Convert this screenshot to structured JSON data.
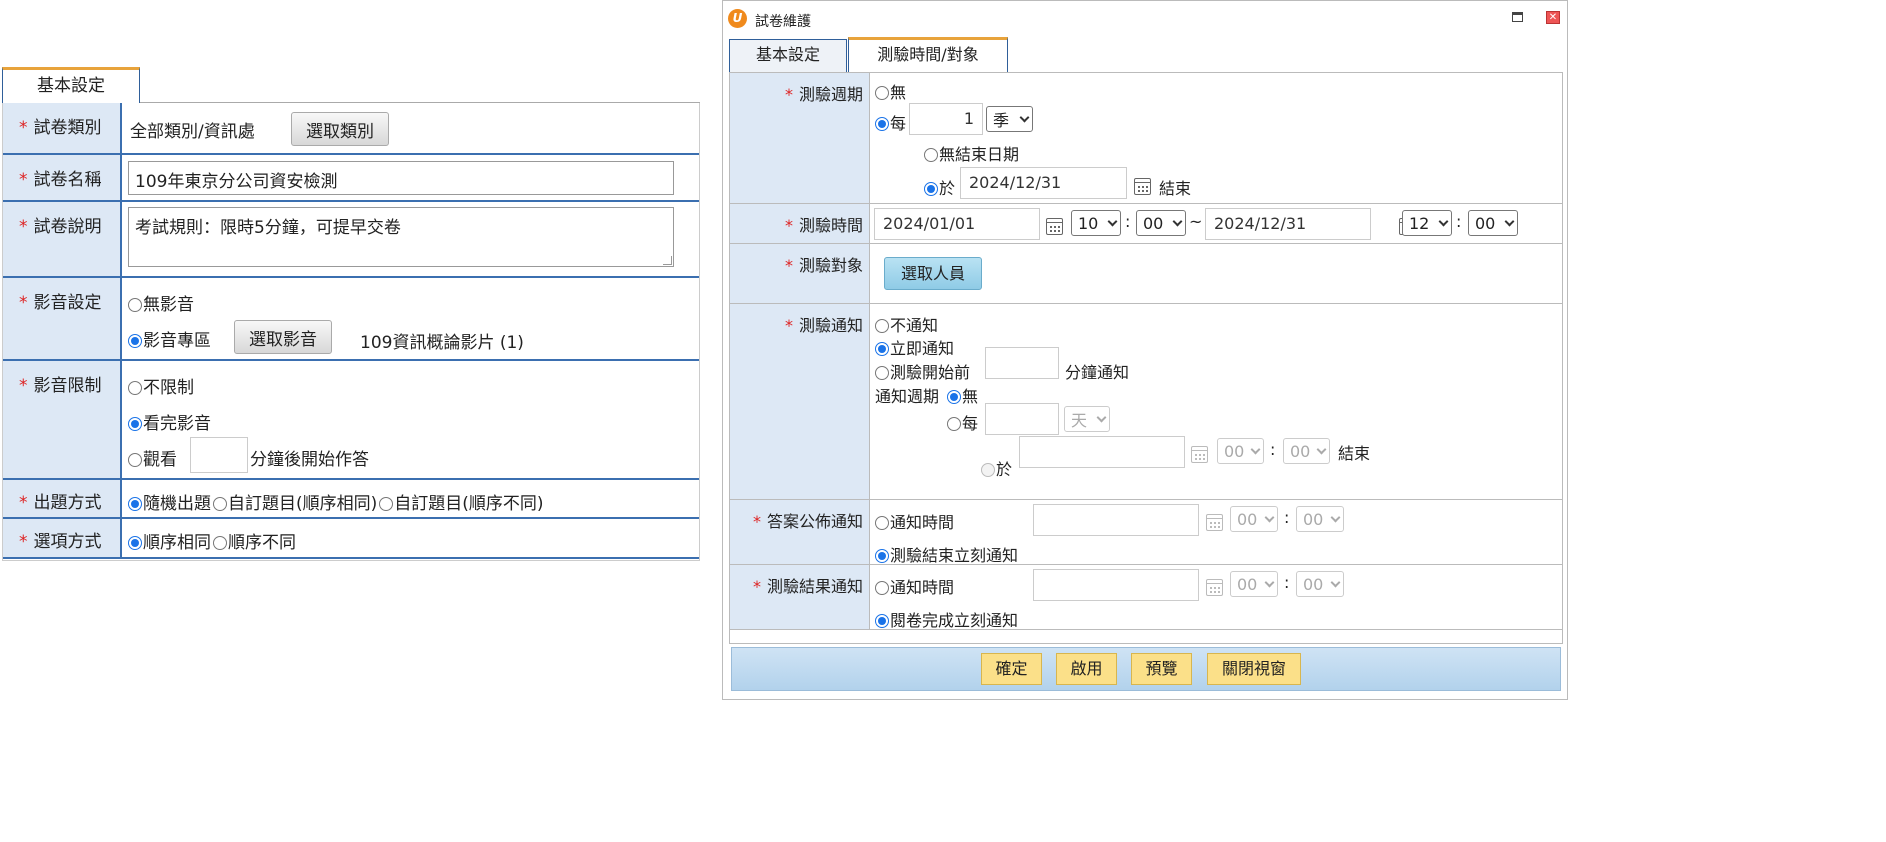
{
  "left": {
    "tab": "基本設定",
    "category": {
      "label": "試卷類別",
      "value": "全部類別/資訊處",
      "button": "選取類別"
    },
    "name": {
      "label": "試卷名稱",
      "value": "109年東京分公司資安檢測"
    },
    "desc": {
      "label": "試卷說明",
      "value": "考試規則：限時5分鐘，可提早交卷"
    },
    "media": {
      "label": "影音設定",
      "opt_none": "無影音",
      "opt_area": "影音專區",
      "button": "選取影音",
      "selected": "109資訊概論影片 (1)"
    },
    "media_limit": {
      "label": "影音限制",
      "opt1": "不限制",
      "opt2": "看完影音",
      "opt3_pre": "觀看",
      "opt3_value": "",
      "opt3_post": "分鐘後開始作答"
    },
    "question_mode": {
      "label": "出題方式",
      "opt1": "隨機出題",
      "opt2": "自訂題目(順序相同)",
      "opt3": "自訂題目(順序不同)"
    },
    "option_mode": {
      "label": "選項方式",
      "opt1": "順序相同",
      "opt2": "順序不同"
    }
  },
  "dialog": {
    "title": "試卷維護",
    "tabs": [
      "基本設定",
      "測驗時間/對象"
    ],
    "cycle": {
      "label": "測驗週期",
      "opt_none": "無",
      "opt_every": "每",
      "every_value": "1",
      "unit": "季",
      "no_end": "無結束日期",
      "at": "於",
      "end_date": "2024/12/31",
      "end_label": "結束"
    },
    "time": {
      "label": "測驗時間",
      "start_date": "2024/01/01",
      "start_hour": "10",
      "start_min": "00",
      "sep": ":",
      "tilde": "~",
      "end_date": "2024/12/31",
      "end_hour": "12",
      "end_min": "00"
    },
    "target": {
      "label": "測驗對象",
      "button": "選取人員"
    },
    "notify": {
      "label": "測驗通知",
      "opt_no": "不通知",
      "opt_now": "立即通知",
      "opt_before": "測驗開始前",
      "before_post": "分鐘通知",
      "cycle_label": "通知週期",
      "cycle_none": "無",
      "cycle_every": "每",
      "cycle_unit": "天",
      "cycle_at": "於",
      "hour": "00",
      "min": "00",
      "end_label": "結束"
    },
    "answer": {
      "label": "答案公佈通知",
      "opt_time": "通知時間",
      "hour": "00",
      "min": "00",
      "opt_end": "測驗結束立刻通知"
    },
    "result": {
      "label": "測驗結果通知",
      "opt_time": "通知時間",
      "hour": "00",
      "min": "00",
      "opt_done": "閱卷完成立刻通知"
    },
    "buttons": {
      "ok": "確定",
      "enable": "啟用",
      "preview": "預覽",
      "close": "關閉視窗"
    }
  }
}
